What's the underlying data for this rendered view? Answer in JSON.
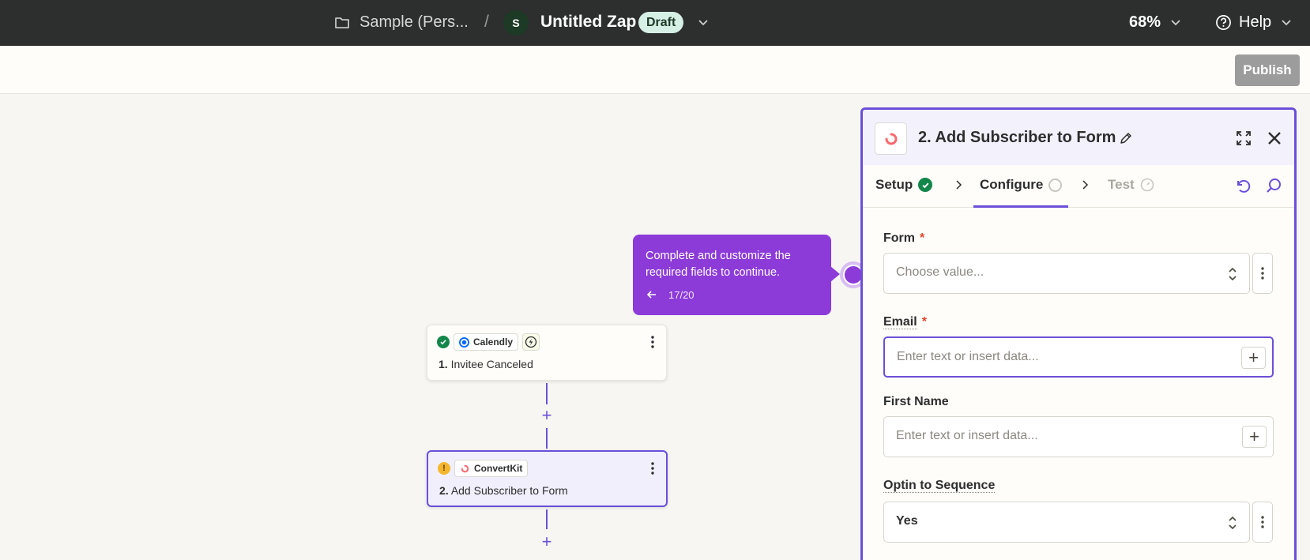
{
  "topbar": {
    "folder_name": "Sample (Pers...",
    "separator": "/",
    "avatar_initial": "S",
    "zap_title": "Untitled Zap",
    "status_badge": "Draft",
    "zoom": "68%",
    "help_label": "Help"
  },
  "toolbar": {
    "publish_label": "Publish"
  },
  "canvas": {
    "steps": [
      {
        "number": "1.",
        "title": "Invitee Canceled",
        "app": "Calendly",
        "status": "complete",
        "is_trigger": true
      },
      {
        "number": "2.",
        "title": "Add Subscriber to Form",
        "app": "ConvertKit",
        "status": "warning",
        "is_trigger": false
      }
    ],
    "add_step_symbol": "+"
  },
  "tooltip": {
    "text": "Complete and customize the required fields to continue.",
    "step": "17/20"
  },
  "panel": {
    "title": "2. Add Subscriber to Form",
    "tabs": [
      {
        "label": "Setup",
        "state": "complete"
      },
      {
        "label": "Configure",
        "state": "active"
      },
      {
        "label": "Test",
        "state": "disabled"
      }
    ],
    "fields": [
      {
        "label": "Form",
        "required": true,
        "type": "select",
        "placeholder": "Choose value...",
        "value": ""
      },
      {
        "label": "Email",
        "required": true,
        "type": "text",
        "placeholder": "Enter text or insert data...",
        "value": ""
      },
      {
        "label": "First Name",
        "required": false,
        "type": "text",
        "placeholder": "Enter text or insert data...",
        "value": ""
      },
      {
        "label": "Optin to Sequence",
        "required": false,
        "type": "select",
        "placeholder": "",
        "value": "Yes"
      }
    ],
    "required_marker": "*"
  },
  "colors": {
    "accent": "#6b4fd8",
    "topbar": "#2d2e2e",
    "tooltip": "#8c3bd9",
    "success": "#13864a",
    "warning": "#f5b62d",
    "required": "#e0432a"
  }
}
